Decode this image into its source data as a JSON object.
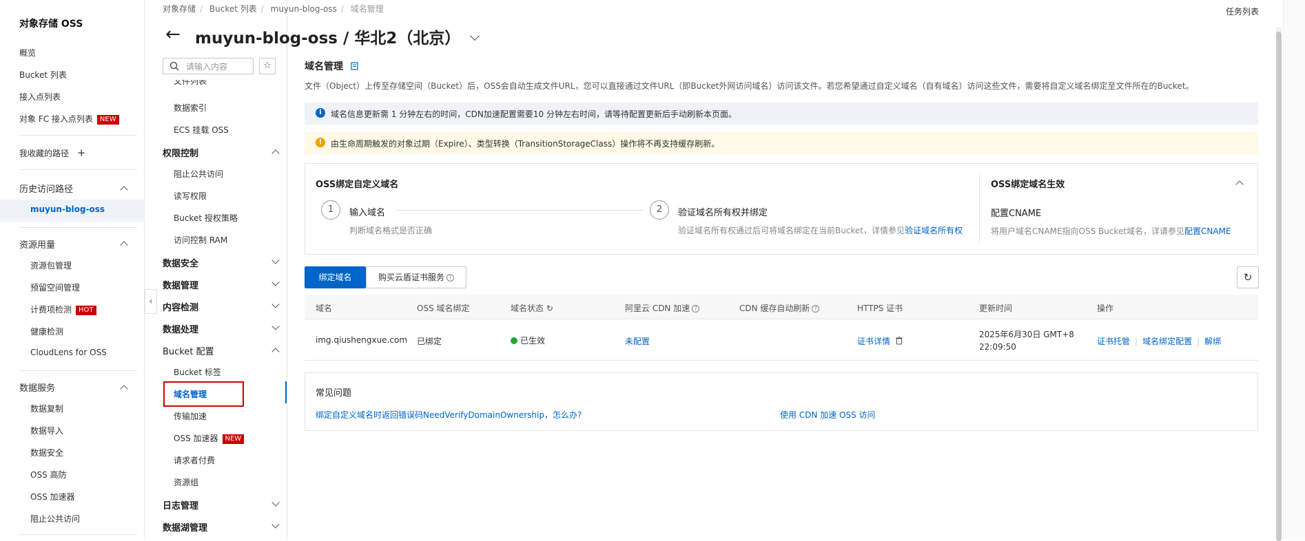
{
  "sidebar": {
    "title": "对象存储 OSS",
    "items": {
      "overview": "概览",
      "bucket_list": "Bucket 列表",
      "access_points": "接入点列表",
      "fc_access_points": "对象 FC 接入点列表",
      "fc_badge": "NEW",
      "favorites": "我收藏的路径",
      "history": "历史访问路径",
      "history_item": "muyun-blog-oss",
      "resource_usage": "资源用量",
      "resource_pack": "资源包管理",
      "reserved_space": "预留空间管理",
      "billing_check": "计费项检测",
      "billing_badge": "HOT",
      "health_check": "健康检测",
      "cloudlens": "CloudLens for OSS",
      "data_service": "数据服务",
      "data_replication": "数据复制",
      "data_import": "数据导入",
      "data_security": "数据安全",
      "oss_defense": "OSS 高防",
      "oss_accelerator": "OSS 加速器",
      "block_public": "阻止公共访问"
    }
  },
  "nav2": {
    "search_placeholder": "请输入内容",
    "file_list_partial": "文件列表",
    "data_index": "数据索引",
    "ecs_mount": "ECS 挂载 OSS",
    "perm_control": "权限控制",
    "block_public": "阻止公共访问",
    "rw_perm": "读写权限",
    "bucket_policy": "Bucket 授权策略",
    "ram_control": "访问控制 RAM",
    "data_security": "数据安全",
    "data_management": "数据管理",
    "content_detect": "内容检测",
    "data_processing": "数据处理",
    "bucket_config": "Bucket 配置",
    "bucket_tags": "Bucket 标签",
    "domain_mgmt": "域名管理",
    "transfer_accel": "传输加速",
    "oss_accel": "OSS 加速器",
    "oss_accel_badge": "NEW",
    "requester_pays": "请求者付费",
    "resource_group": "资源组",
    "log_mgmt": "日志管理",
    "datalake_mgmt": "数据湖管理"
  },
  "header": {
    "breadcrumb": [
      "对象存储",
      "Bucket 列表",
      "muyun-blog-oss",
      "域名管理"
    ],
    "title": "muyun-blog-oss / 华北2（北京）",
    "task_list": "任务列表"
  },
  "main": {
    "section_title": "域名管理",
    "description": "文件（Object）上传至存储空间（Bucket）后，OSS会自动生成文件URL，您可以直接通过文件URL（即Bucket外网访问域名）访问该文件。若您希望通过自定义域名（自有域名）访问这些文件，需要将自定义域名绑定至文件所在的Bucket。",
    "info_alert": "域名信息更新需 1 分钟左右的时间，CDN加速配置需要10 分钟左右时间，请等待配置更新后手动刷新本页面。",
    "warn_alert": "由生命周期触发的对象过期（Expire）、类型转换（TransitionStorageClass）操作将不再支持缓存刷新。",
    "bind_card": {
      "left_title": "OSS绑定自定义域名",
      "step1_num": "1",
      "step1_title": "输入域名",
      "step1_desc": "判断域名格式是否正确",
      "step2_num": "2",
      "step2_title": "验证域名所有权并绑定",
      "step2_desc": "验证域名所有权通过后可将域名绑定在当前Bucket，详情参见",
      "step2_link": "验证域名所有权",
      "right_title": "OSS绑定域名生效",
      "right_sub": "配置CNAME",
      "right_desc": "将用户域名CNAME指向OSS Bucket域名，详请参见",
      "right_link": "配置CNAME"
    },
    "bind_button": "绑定域名",
    "buy_cert_button": "购买云盾证书服务",
    "table": {
      "headers": [
        "域名",
        "OSS 域名绑定",
        "域名状态",
        "阿里云 CDN 加速",
        "CDN 缓存自动刷新",
        "HTTPS 证书",
        "更新时间",
        "操作"
      ],
      "rows": [
        {
          "domain": "img.qiushengxue.com",
          "bind": "已绑定",
          "status": "已生效",
          "cdn": "未配置",
          "cdn_refresh": "",
          "cert": "证书详情",
          "updated_line1": "2025年6月30日 GMT+8",
          "updated_line2": "22:09:50",
          "op1": "证书托管",
          "op2": "域名绑定配置",
          "op3": "解绑"
        }
      ]
    },
    "faq": {
      "title": "常见问题",
      "q1": "绑定自定义域名时返回错误码NeedVerifyDomainOwnership，怎么办?",
      "q2": "使用 CDN 加速 OSS 访问"
    }
  },
  "colors": {
    "primary": "#0064c8",
    "badge_red": "#c80000",
    "success": "#1ea83c",
    "warn": "#f0a000"
  }
}
